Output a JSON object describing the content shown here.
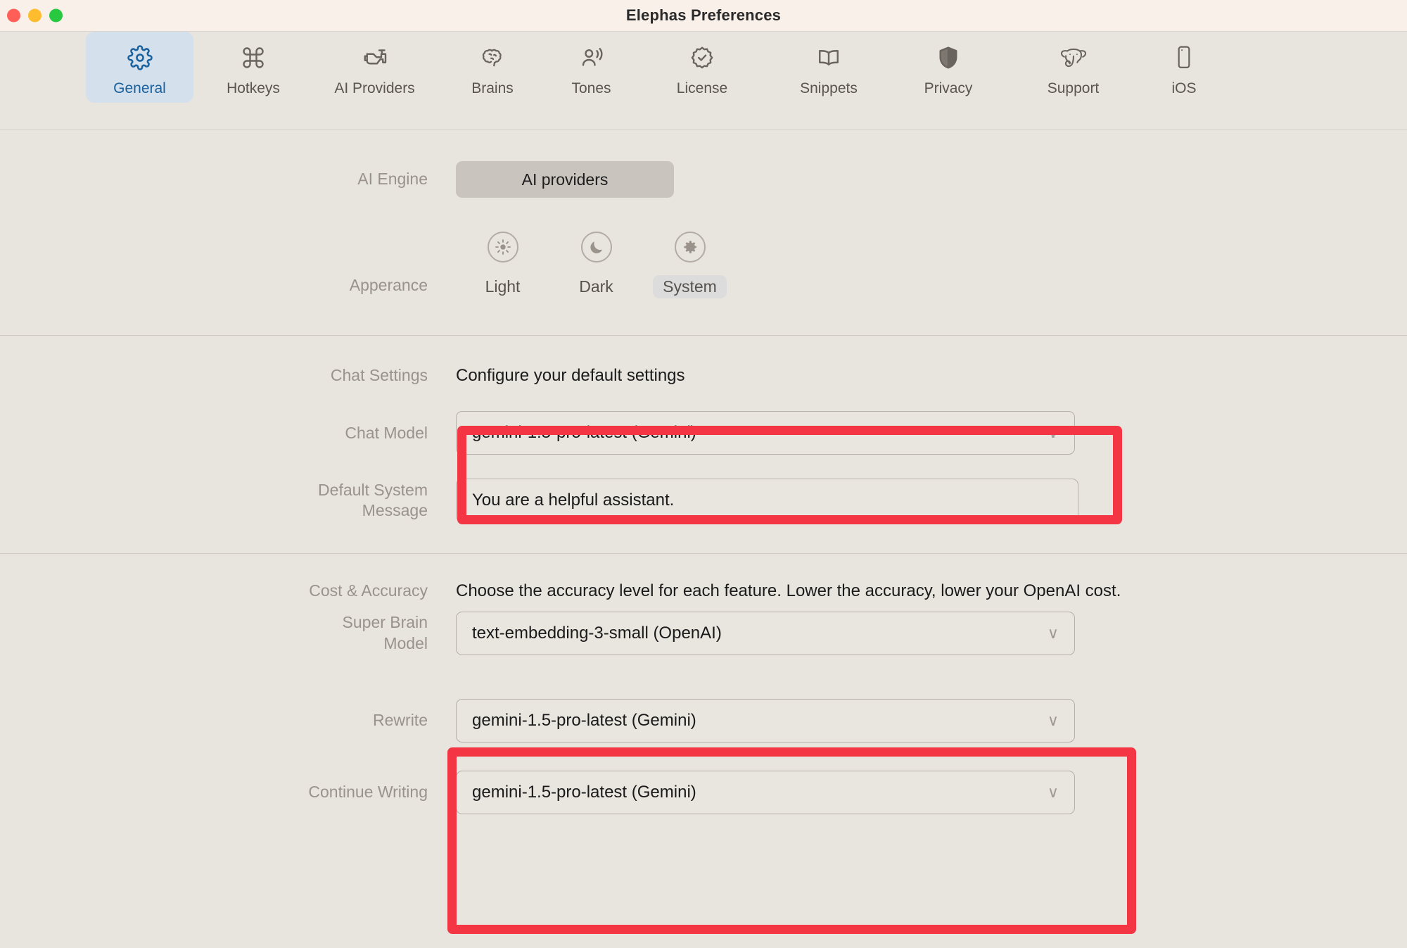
{
  "window": {
    "title": "Elephas Preferences",
    "traffic_lights": [
      "close",
      "minimize",
      "zoom"
    ]
  },
  "toolbar": {
    "tabs": [
      {
        "label": "General",
        "icon": "gear-icon",
        "active": true
      },
      {
        "label": "Hotkeys",
        "icon": "command-icon",
        "active": false
      },
      {
        "label": "AI Providers",
        "icon": "engine-icon",
        "active": false
      },
      {
        "label": "Brains",
        "icon": "brain-icon",
        "active": false
      },
      {
        "label": "Tones",
        "icon": "person-speaking-icon",
        "active": false
      },
      {
        "label": "License",
        "icon": "badge-check-icon",
        "active": false
      },
      {
        "label": "Snippets",
        "icon": "open-book-icon",
        "active": false
      },
      {
        "label": "Privacy",
        "icon": "shield-icon",
        "active": false
      },
      {
        "label": "Support",
        "icon": "elephant-icon",
        "active": false
      },
      {
        "label": "iOS",
        "icon": "phone-icon",
        "active": false
      }
    ]
  },
  "general": {
    "ai_engine": {
      "label": "AI Engine",
      "button_label": "AI providers"
    },
    "appearance": {
      "label": "Apperance",
      "options": [
        {
          "label": "Light",
          "icon": "sun-icon",
          "selected": false
        },
        {
          "label": "Dark",
          "icon": "moon-icon",
          "selected": false
        },
        {
          "label": "System",
          "icon": "gear-icon",
          "selected": true
        }
      ]
    },
    "chat_settings": {
      "label": "Chat Settings",
      "description": "Configure your default settings",
      "chat_model": {
        "label": "Chat Model",
        "value": "gemini-1.5-pro-latest (Gemini)",
        "chevron": "∨",
        "highlighted": true
      },
      "default_system_message": {
        "label_line1": "Default System",
        "label_line2": "Message",
        "value": "You are a helpful assistant."
      }
    },
    "cost_accuracy": {
      "label": "Cost & Accuracy",
      "description": "Choose the accuracy level for each feature. Lower the accuracy, lower your OpenAI cost.",
      "super_brain_model": {
        "label_line1": "Super Brain",
        "label_line2": "Model",
        "value": "text-embedding-3-small (OpenAI)",
        "chevron": "∨"
      },
      "rewrite": {
        "label": "Rewrite",
        "value": "gemini-1.5-pro-latest (Gemini)",
        "chevron": "∨",
        "highlighted": true
      },
      "continue_writing": {
        "label": "Continue Writing",
        "value": "gemini-1.5-pro-latest (Gemini)",
        "chevron": "∨",
        "highlighted": true
      }
    }
  },
  "colors": {
    "titlebar_bg": "#faf0ea",
    "window_bg": "#e8e4de",
    "accent_blue": "#19619e",
    "active_tab_bg": "#d4e0ec",
    "annotation_red": "#f43644",
    "label_gray": "#9a938b"
  }
}
